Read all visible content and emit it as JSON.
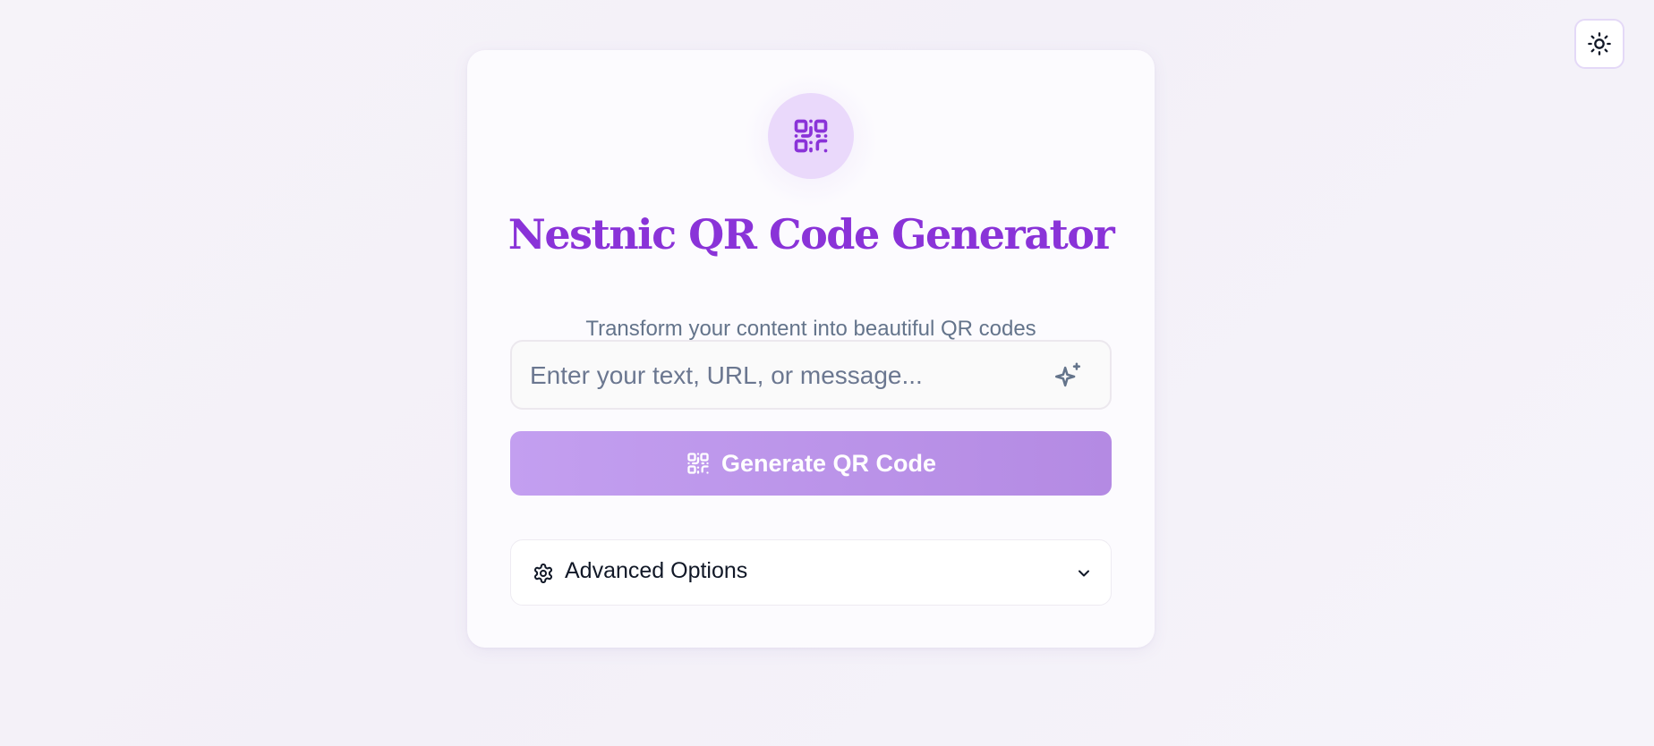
{
  "theme_toggle": {
    "icon": "sun-icon"
  },
  "header": {
    "logo_icon": "qr-code-icon",
    "title": "Nestnic QR Code Generator",
    "subtitle": "Transform your content into beautiful QR codes"
  },
  "input": {
    "placeholder": "Enter your text, URL, or message...",
    "value": "",
    "icon": "sparkle-icon"
  },
  "generate_button": {
    "label": "Generate QR Code",
    "icon": "qr-code-icon"
  },
  "advanced_options": {
    "label": "Advanced Options",
    "icon": "gear-icon",
    "toggle_icon": "chevron-down-icon"
  },
  "colors": {
    "accent": "#8a33d8",
    "button_gradient_start": "#c39ff0",
    "button_gradient_end": "#b48ae3",
    "logo_bg": "#ead9fb",
    "subtitle": "#64748b"
  }
}
